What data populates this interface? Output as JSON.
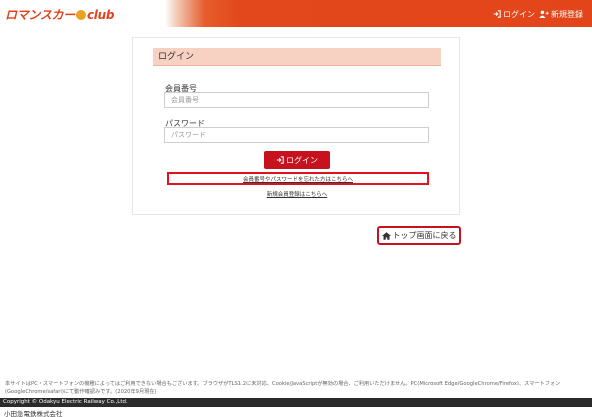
{
  "header": {
    "logo_text": "ロマンスカー",
    "logo_suffix": "club",
    "login_label": "ログイン",
    "register_label": "新規登録"
  },
  "login_card": {
    "title": "ログイン",
    "member_number_label": "会員番号",
    "member_number_placeholder": "会員番号",
    "password_label": "パスワード",
    "password_placeholder": "パスワード",
    "login_button_label": "ログイン",
    "forgot_link": "会員番号やパスワードを忘れた方はこちらへ",
    "register_link": "新規会員登録はこちらへ"
  },
  "top_button_label": "トップ画面に戻る",
  "footer": {
    "notice": "本サイトはPC・スマートフォンの機種によってはご利用できない場合もございます。ブラウザがTLS1.2に未対応、Cookie/JavaScriptが無効の場合、ご利用いただけません。PC(Microsoft Edge/GoogleChrome/Firefox)、スマートフォン(GoogleChrome/safari)にて動作確認みです。(2020年9月現在)",
    "copyright": "Copyright © Odakyu Electric Railway Co.,Ltd.",
    "company": "小田急電鉄株式会社"
  },
  "colors": {
    "brand_red": "#c8111e",
    "header_orange": "#e24519",
    "card_title_bg": "#f7d2c3"
  }
}
